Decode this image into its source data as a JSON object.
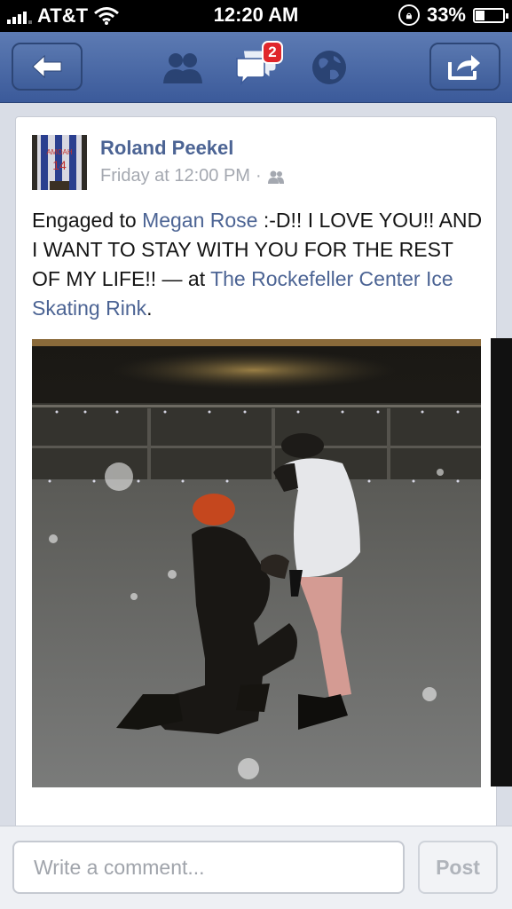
{
  "status_bar": {
    "carrier": "AT&T",
    "time": "12:20 AM",
    "battery_percent": "33%",
    "battery_level": 0.33,
    "icons": [
      "signal-icon",
      "wifi-icon",
      "rotation-lock-icon",
      "battery-icon"
    ]
  },
  "nav": {
    "back_icon": "back-arrow-icon",
    "friends_icon": "friend-requests-icon",
    "messages_icon": "messages-icon",
    "messages_badge": "2",
    "notifications_icon": "globe-icon",
    "share_icon": "share-icon",
    "badge_color": "#e0262b",
    "bar_color": "#3b5a9a"
  },
  "post": {
    "author": "Roland Peekel",
    "avatar_jersey_name": "AMOAH",
    "avatar_jersey_number": "14",
    "timestamp": "Friday at 12:00 PM",
    "separator": "·",
    "privacy_icon": "friends-audience-icon",
    "text_prefix": "Engaged to ",
    "tagged_person": "Megan Rose",
    "text_body": " :-D!! I LOVE YOU!! AND I WANT TO STAY WITH YOU FOR THE REST OF MY LIFE!! — at ",
    "location": "The Rockefeller Center Ice Skating Rink",
    "text_suffix": ".",
    "link_color": "#4c6494"
  },
  "comment": {
    "placeholder": "Write a comment...",
    "post_label": "Post"
  }
}
